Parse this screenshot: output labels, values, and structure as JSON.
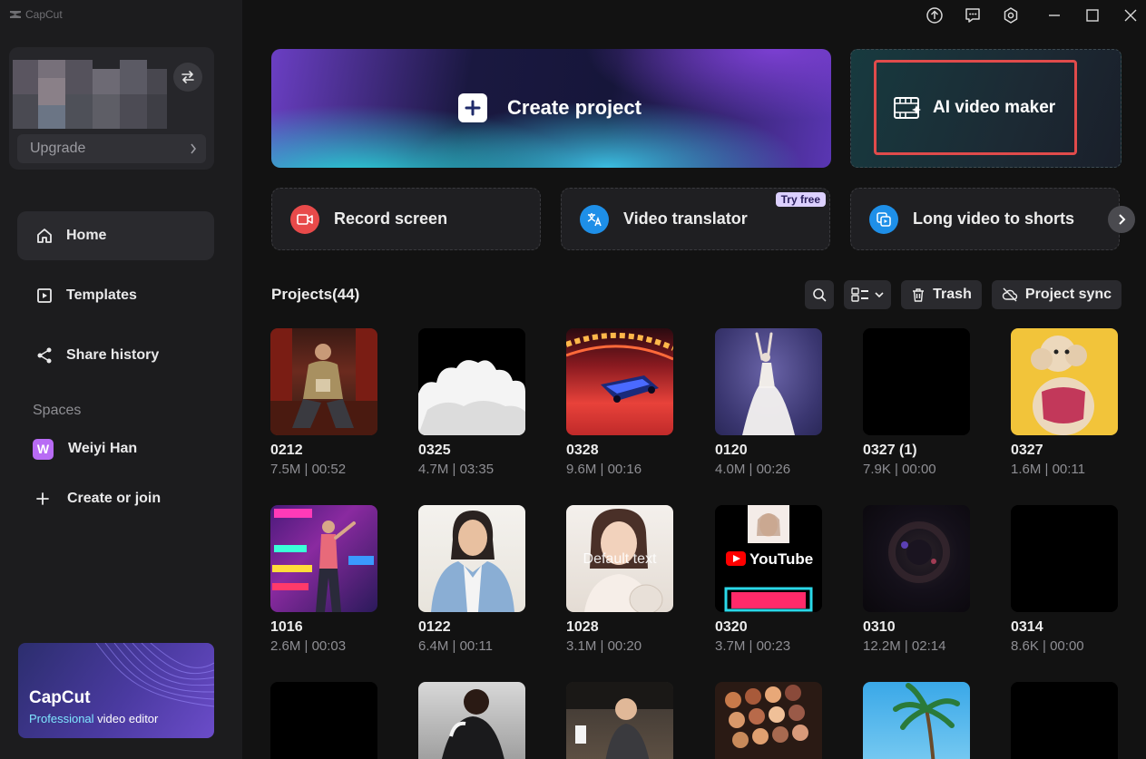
{
  "app": {
    "name": "CapCut"
  },
  "account": {
    "upgrade_label": "Upgrade"
  },
  "nav": [
    {
      "label": "Home",
      "icon": "home-icon",
      "active": true
    },
    {
      "label": "Templates",
      "icon": "templates-icon",
      "active": false
    },
    {
      "label": "Share history",
      "icon": "share-icon",
      "active": false
    }
  ],
  "spaces": {
    "label": "Spaces",
    "items": [
      {
        "label": "Weiyi Han",
        "badge": "W"
      },
      {
        "label": "Create or join",
        "icon": "plus-icon"
      }
    ]
  },
  "promo": {
    "title": "CapCut",
    "subtitle_accent": "Professional",
    "subtitle_rest": " video editor"
  },
  "hero": {
    "create_label": "Create project",
    "ai_label": "AI video maker"
  },
  "tools": [
    {
      "label": "Record screen",
      "icon": "record-icon",
      "color": "#e84a4a"
    },
    {
      "label": "Video translator",
      "icon": "translate-icon",
      "color": "#1e8fe8",
      "badge": "Try free"
    },
    {
      "label": "Long video to shorts",
      "icon": "shorts-icon",
      "color": "#1e8fe8"
    }
  ],
  "projects": {
    "title": "Projects(44)",
    "toolbar": {
      "trash_label": "Trash",
      "sync_label": "Project sync"
    },
    "items": [
      {
        "name": "0212",
        "meta": "7.5M | 00:52"
      },
      {
        "name": "0325",
        "meta": "4.7M | 03:35"
      },
      {
        "name": "0328",
        "meta": "9.6M | 00:16"
      },
      {
        "name": "0120",
        "meta": "4.0M | 00:26"
      },
      {
        "name": "0327 (1)",
        "meta": "7.9K | 00:00"
      },
      {
        "name": "0327",
        "meta": "1.6M | 00:11"
      },
      {
        "name": "1016",
        "meta": "2.6M | 00:03"
      },
      {
        "name": "0122",
        "meta": "6.4M | 00:11"
      },
      {
        "name": "1028",
        "meta": "3.1M | 00:20",
        "overlay": "Default text"
      },
      {
        "name": "0320",
        "meta": "3.7M | 00:23",
        "overlay": "YouTube"
      },
      {
        "name": "0310",
        "meta": "12.2M | 02:14"
      },
      {
        "name": "0314",
        "meta": "8.6K | 00:00"
      }
    ]
  }
}
